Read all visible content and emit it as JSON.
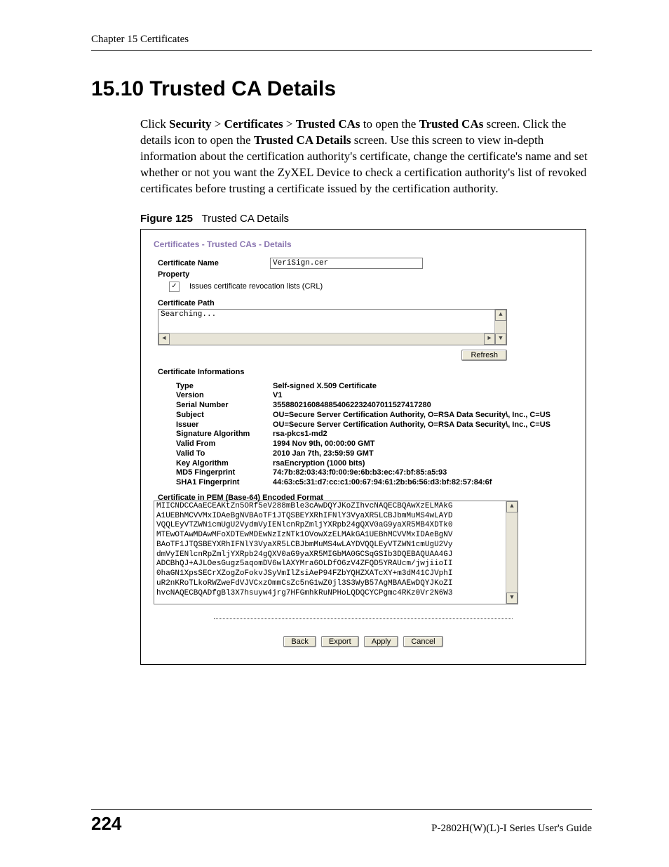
{
  "header": {
    "running_head": "Chapter 15 Certificates",
    "section_title": "15.10  Trusted CA Details"
  },
  "paragraph": {
    "pre": "Click ",
    "bold1": "Security",
    "gt1": " > ",
    "bold2": "Certificates",
    "gt2": " > ",
    "bold3": "Trusted CAs",
    "mid1": " to open the ",
    "bold4": "Trusted CAs",
    "mid2": " screen. Click the details icon to open the ",
    "bold5": "Trusted CA Details",
    "tail": " screen. Use this screen to view in-depth information about the certification authority's certificate, change the certificate's name and set whether or not you want the ZyXEL Device to check a certification authority's list of revoked certificates before trusting a certificate issued by the certification authority."
  },
  "figure": {
    "label": "Figure 125",
    "title": "Trusted CA Details"
  },
  "ui": {
    "breadcrumb": "Certificates - Trusted CAs - Details",
    "cert_name_label": "Certificate Name",
    "cert_name_value": "VeriSign.cer",
    "property_label": "Property",
    "crl_check": "✓",
    "crl_text": "Issues certificate revocation lists (CRL)",
    "cert_path_label": "Certificate Path",
    "cert_path_value": "Searching...",
    "refresh_btn": "Refresh",
    "cert_info_label": "Certificate Informations",
    "info": {
      "type_k": "Type",
      "type_v": "Self-signed X.509 Certificate",
      "version_k": "Version",
      "version_v": "V1",
      "serial_k": "Serial Number",
      "serial_v": "3558802160848854062232407011527417280",
      "subject_k": "Subject",
      "subject_v": "OU=Secure Server Certification Authority, O=RSA Data Security\\, Inc., C=US",
      "issuer_k": "Issuer",
      "issuer_v": "OU=Secure Server Certification Authority, O=RSA Data Security\\, Inc., C=US",
      "sigalg_k": "Signature Algorithm",
      "sigalg_v": "rsa-pkcs1-md2",
      "validfrom_k": "Valid From",
      "validfrom_v": "1994 Nov 9th, 00:00:00 GMT",
      "validto_k": "Valid To",
      "validto_v": "2010 Jan 7th, 23:59:59 GMT",
      "keyalg_k": "Key Algorithm",
      "keyalg_v": "rsaEncryption (1000 bits)",
      "md5_k": "MD5 Fingerprint",
      "md5_v": "74:7b:82:03:43:f0:00:9e:6b:b3:ec:47:bf:85:a5:93",
      "sha1_k": "SHA1 Fingerprint",
      "sha1_v": "44:63:c5:31:d7:cc:c1:00:67:94:61:2b:b6:56:d3:bf:82:57:84:6f"
    },
    "pem_label": "Certificate in PEM (Base-64) Encoded Format",
    "pem_value": "MIICNDCCAaECEAKtZn5ORf5eV288mBle3cAwDQYJKoZIhvcNAQECBQAwXzELMAkG\nA1UEBhMCVVMxIDAeBgNVBAoTF1JTQSBEYXRhIFNlY3VyaXR5LCBJbmMuMS4wLAYD\nVQQLEyVTZWN1cmUgU2VydmVyIENlcnRpZmljYXRpb24gQXV0aG9yaXR5MB4XDTk0\nMTEwOTAwMDAwMFoXDTEwMDEwNzIzNTk1OVowXzELMAkGA1UEBhMCVVMxIDAeBgNV\nBAoTF1JTQSBEYXRhIFNlY3VyaXR5LCBJbmMuMS4wLAYDVQQLEyVTZWN1cmUgU2Vy\ndmVyIENlcnRpZmljYXRpb24gQXV0aG9yaXR5MIGbMA0GCSqGSIb3DQEBAQUAA4GJ\nADCBhQJ+AJLOesGugz5aqomDV6wlAXYMra6OLDfO6zV4ZFQD5YRAUcm/jwjiioII\n0haGN1XpsSECrXZogZoFokvJSyVmIlZsiAeP94FZbYQHZXATcXY+m3dM41CJVphI\nuR2nKRoTLkoRWZweFdVJVCxzOmmCsZc5nG1wZ0jl3S3WyB57AgMBAAEwDQYJKoZI\nhvcNAQECBQADfgBl3X7hsuyw4jrg7HFGmhkRuNPHoLQDQCYCPgmc4RKz0Vr2N6W3",
    "buttons": {
      "back": "Back",
      "export": "Export",
      "apply": "Apply",
      "cancel": "Cancel"
    },
    "arrows": {
      "up": "▲",
      "down": "▼",
      "left": "◄",
      "right": "►"
    }
  },
  "footer": {
    "page_num": "224",
    "guide": "P-2802H(W)(L)-I Series User's Guide"
  }
}
